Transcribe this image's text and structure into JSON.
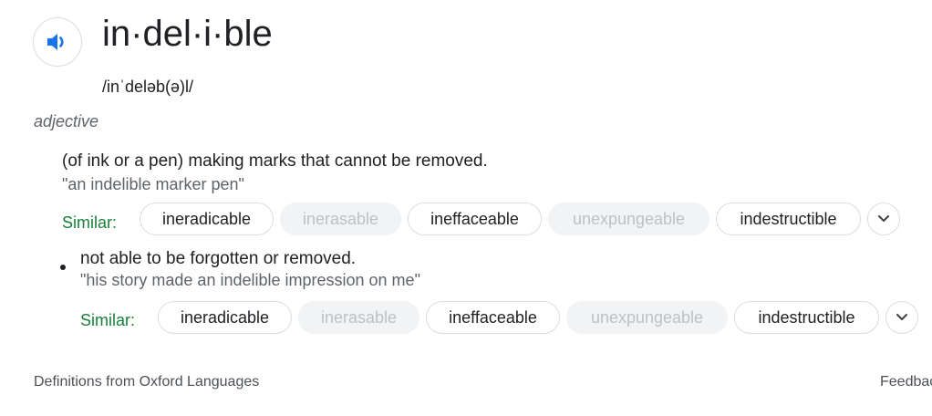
{
  "entry": {
    "headword": "in·del·i·ble",
    "phonetic": "/inˈdeləb(ə)l/",
    "part_of_speech": "adjective",
    "speaker_icon": "speaker-volume-icon",
    "senses": [
      {
        "definition": "(of ink or a pen) making marks that cannot be removed.",
        "example": "\"an indelible marker pen\"",
        "similar_label": "Similar:",
        "similar": [
          "ineradicable",
          "inerasable",
          "ineffaceable",
          "unexpungeable",
          "indestructible"
        ]
      },
      {
        "definition": "not able to be forgotten or removed.",
        "example": "\"his story made an indelible impression on me\"",
        "similar_label": "Similar:",
        "similar": [
          "ineradicable",
          "inerasable",
          "ineffaceable",
          "unexpungeable",
          "indestructible"
        ]
      }
    ],
    "expand_icon": "chevron-down-icon"
  },
  "footer": {
    "source": "Definitions from Oxford Languages",
    "feedback": "Feedback"
  },
  "colors": {
    "speaker_blue": "#1a73e8",
    "similar_green": "#188038",
    "muted_chip": "#f1f3f4"
  }
}
